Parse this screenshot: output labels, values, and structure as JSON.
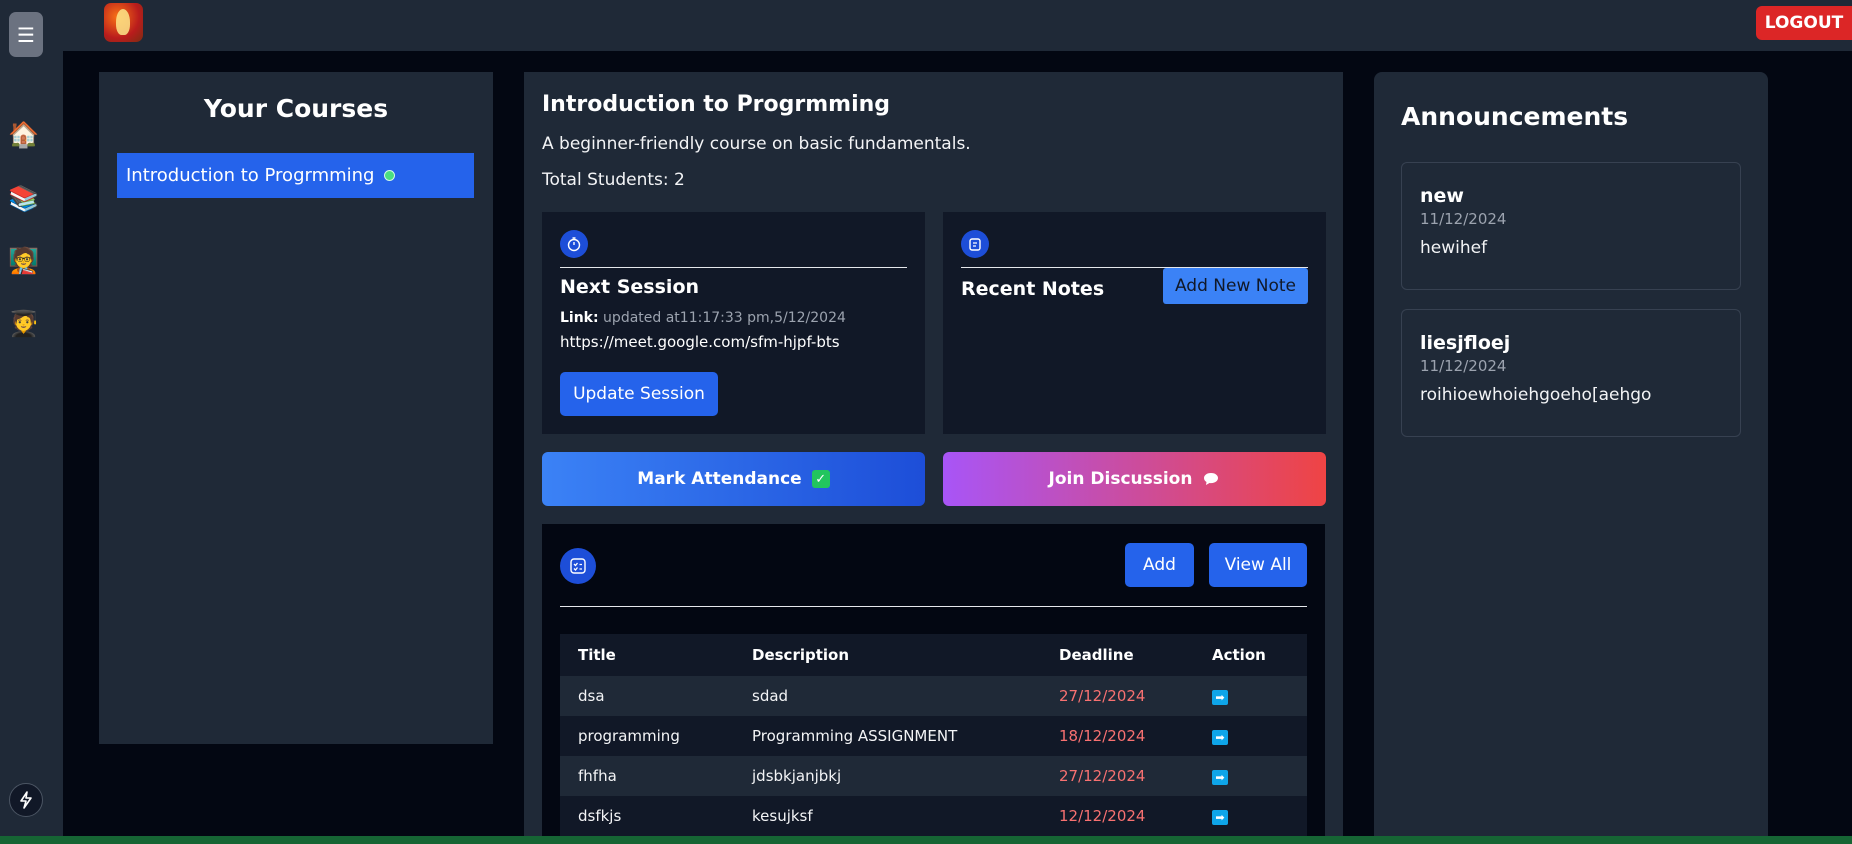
{
  "header": {
    "logout_label": "LOGOUT"
  },
  "rail": {
    "menu_glyph": "☰",
    "items": [
      "🏠",
      "📚",
      "🧑‍🏫",
      "🧑‍🎓"
    ],
    "bolt_glyph": "⚡"
  },
  "courses": {
    "title": "Your Courses",
    "items": [
      {
        "label": "Introduction to Progrmming",
        "active": true
      }
    ]
  },
  "course": {
    "title": "Introduction to Progrmming",
    "description": "A beginner-friendly course on basic fundamentals.",
    "students": "Total Students: 2"
  },
  "next_session": {
    "heading": "Next Session",
    "link_label": "Link:",
    "updated": " updated at11:17:33 pm,5/12/2024",
    "url": "https://meet.google.com/sfm-hjpf-bts",
    "update_button": "Update Session"
  },
  "notes": {
    "heading": "Recent Notes",
    "add_button": "Add New Note"
  },
  "actions": {
    "attendance": "Mark Attendance",
    "discussion": "Join Discussion"
  },
  "assignments": {
    "add_button": "Add",
    "view_all_button": "View All",
    "columns": [
      "Title",
      "Description",
      "Deadline",
      "Action"
    ],
    "rows": [
      {
        "title": "dsa",
        "description": "sdad",
        "deadline": "27/12/2024"
      },
      {
        "title": "programming",
        "description": "Programming ASSIGNMENT",
        "deadline": "18/12/2024"
      },
      {
        "title": "fhfha",
        "description": "jdsbkjanjbkj",
        "deadline": "27/12/2024"
      },
      {
        "title": "dsfkjs",
        "description": "kesujksf",
        "deadline": "12/12/2024"
      }
    ]
  },
  "announcements": {
    "title": "Announcements",
    "items": [
      {
        "title": "new",
        "date": "11/12/2024",
        "body": "hewihef"
      },
      {
        "title": "liesjfloej",
        "date": "11/12/2024",
        "body": "roihioewhoiehgoeho[aehgo"
      }
    ]
  },
  "colors": {
    "accent": "#2563eb",
    "danger": "#dc2626",
    "deadline": "#f87171"
  }
}
